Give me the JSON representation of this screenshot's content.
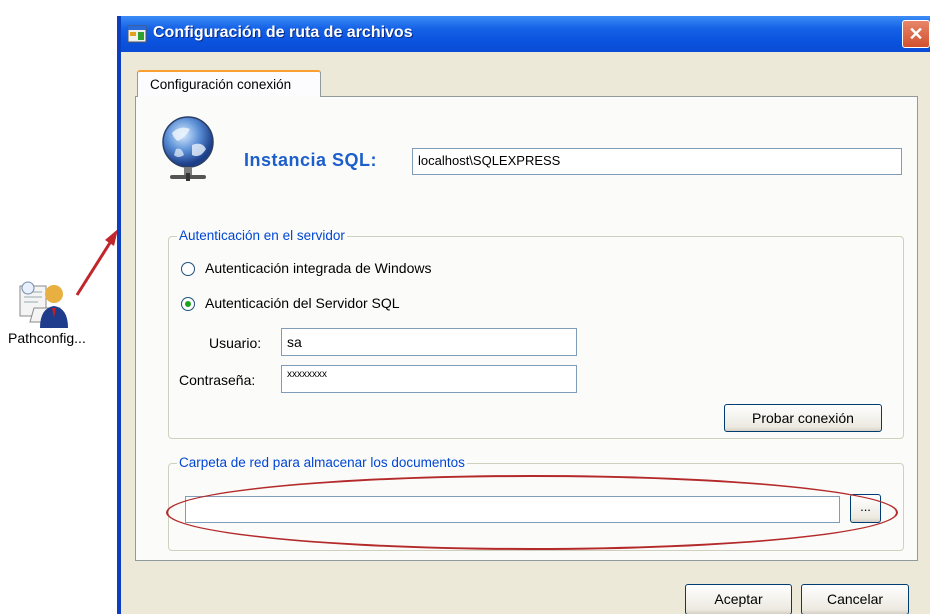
{
  "desktop": {
    "icon_label": "Pathconfig..."
  },
  "window": {
    "title": "Configuración de ruta de archivos",
    "close_glyph": "✕"
  },
  "tabs": [
    {
      "label": "Configuración conexión",
      "active": true
    }
  ],
  "sql": {
    "label": "Instancia SQL:",
    "instance_value": "localhost\\SQLEXPRESS"
  },
  "auth": {
    "group_title": "Autenticación en el servidor",
    "options": [
      {
        "label": "Autenticación integrada de Windows",
        "selected": false
      },
      {
        "label": "Autenticación del Servidor SQL",
        "selected": true
      }
    ],
    "user_label": "Usuario:",
    "user_value": "sa",
    "password_label": "Contraseña:",
    "password_value": "xxxxxxxx",
    "test_button": "Probar conexión"
  },
  "folder": {
    "group_title": "Carpeta de red para almacenar los documentos",
    "path_value": "",
    "browse_button": "..."
  },
  "footer": {
    "ok_button": "Aceptar",
    "cancel_button": "Cancelar"
  },
  "icons": [
    "app-icon",
    "pathconfig-icon",
    "globe-icon",
    "close-icon"
  ],
  "colors": {
    "titlebar": "#0a53df",
    "accent_label": "#1c5ecb",
    "group_label": "#0046d5",
    "annotation": "#b42a2a",
    "dialog_bg": "#ece9d8"
  }
}
